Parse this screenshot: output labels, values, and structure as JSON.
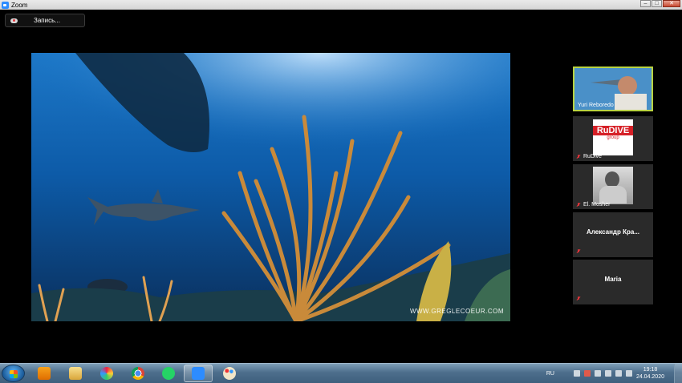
{
  "window": {
    "title": "Zoom",
    "buttons": [
      "minimize",
      "maximize",
      "close"
    ]
  },
  "recording": {
    "label": "Запись..."
  },
  "shared_screen": {
    "watermark": "WWW.GREGLECOEUR.COM"
  },
  "participants": [
    {
      "name": "Yuri Reboredo",
      "type": "video",
      "active": true,
      "muted": false
    },
    {
      "name": "RuDive",
      "type": "image",
      "active": false,
      "muted": true,
      "logo_text": "RuDIVE",
      "logo_sub": "group"
    },
    {
      "name": "El. Mosher",
      "type": "image",
      "active": false,
      "muted": true
    },
    {
      "name": "Александр  Кра...",
      "type": "name-only",
      "active": false,
      "muted": true
    },
    {
      "name": "Maria",
      "type": "name-only",
      "active": false,
      "muted": true
    }
  ],
  "taskbar": {
    "apps": [
      "windows-media-player",
      "file-explorer",
      "photo-gallery",
      "google-chrome",
      "whatsapp",
      "zoom",
      "paint"
    ],
    "active_app": "zoom",
    "language": "RU",
    "time": "19:18",
    "date": "24.04.2020"
  },
  "colors": {
    "active_speaker_border": "#b9d342",
    "mute_red": "#e0353a",
    "zoom_blue": "#2d8cff"
  }
}
